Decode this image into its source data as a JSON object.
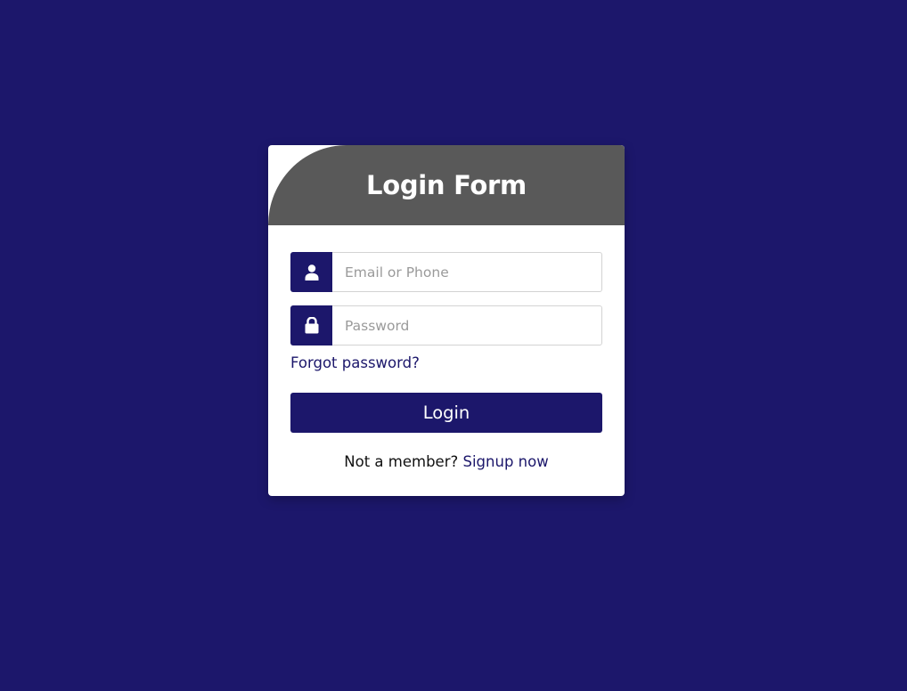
{
  "form": {
    "title": "Login Form",
    "email": {
      "placeholder": "Email or Phone",
      "value": "",
      "icon": "user-icon"
    },
    "password": {
      "placeholder": "Password",
      "value": "",
      "icon": "lock-icon"
    },
    "forgot_label": "Forgot password?",
    "login_label": "Login",
    "signup_prompt": "Not a member?",
    "signup_label": "Signup now"
  },
  "colors": {
    "background": "#1c176b",
    "header": "#595959",
    "accent": "#1c176b",
    "card": "#ffffff"
  }
}
